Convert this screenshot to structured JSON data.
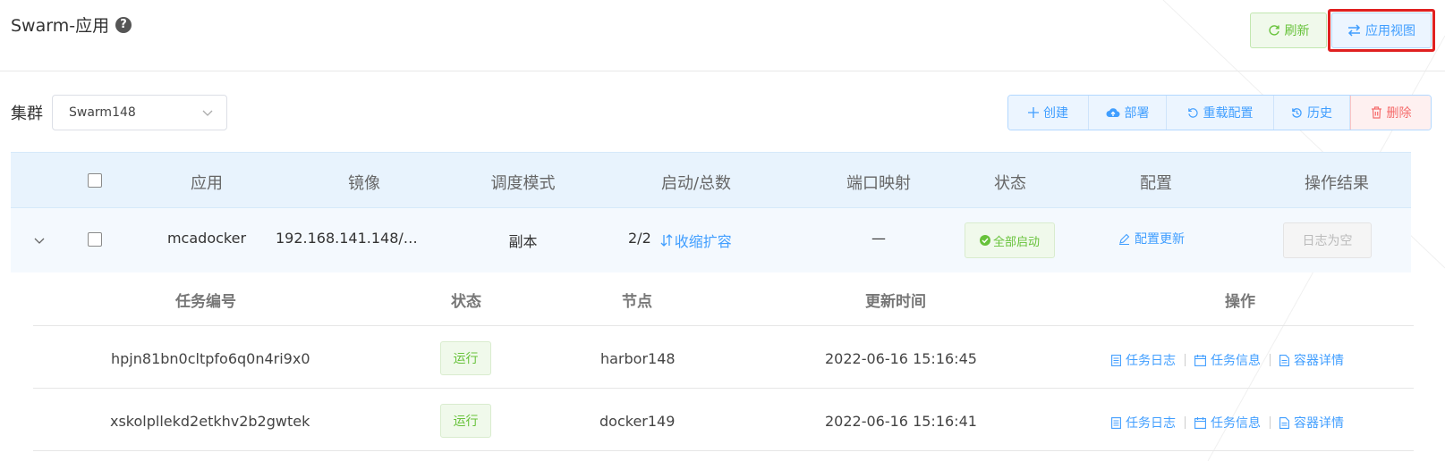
{
  "header": {
    "title": "Swarm-应用",
    "help_glyph": "?",
    "refresh_label": "刷新",
    "app_view_label": "应用视图"
  },
  "filter": {
    "cluster_label": "集群",
    "cluster_value": "Swarm148"
  },
  "actions": {
    "create": "创建",
    "deploy": "部署",
    "reload_config": "重载配置",
    "history": "历史",
    "delete": "删除"
  },
  "table": {
    "columns": [
      "应用",
      "镜像",
      "调度模式",
      "启动/总数",
      "端口映射",
      "状态",
      "配置",
      "操作结果"
    ],
    "row": {
      "app": "mcadocker",
      "image": "192.168.141.148/…",
      "schedule_mode": "副本",
      "start_total": "2/2",
      "scale_label": "收缩扩容",
      "ports": "—",
      "status": "全部启动",
      "config": "配置更新",
      "result": "日志为空"
    }
  },
  "tasks": {
    "columns": [
      "任务编号",
      "状态",
      "节点",
      "更新时间",
      "操作"
    ],
    "ops": [
      "任务日志",
      "任务信息",
      "容器详情"
    ],
    "rows": [
      {
        "id": "hpjn81bn0cltpfo6q0n4ri9x0",
        "status": "运行",
        "node": "harbor148",
        "time": "2022-06-16 15:16:45"
      },
      {
        "id": "xskolpllekd2etkhv2b2gwtek",
        "status": "运行",
        "node": "docker149",
        "time": "2022-06-16 15:16:41"
      }
    ]
  },
  "colors": {
    "primary": "#409eff",
    "success": "#67c23a",
    "danger": "#f56c6c",
    "highlight": "#e02020"
  }
}
